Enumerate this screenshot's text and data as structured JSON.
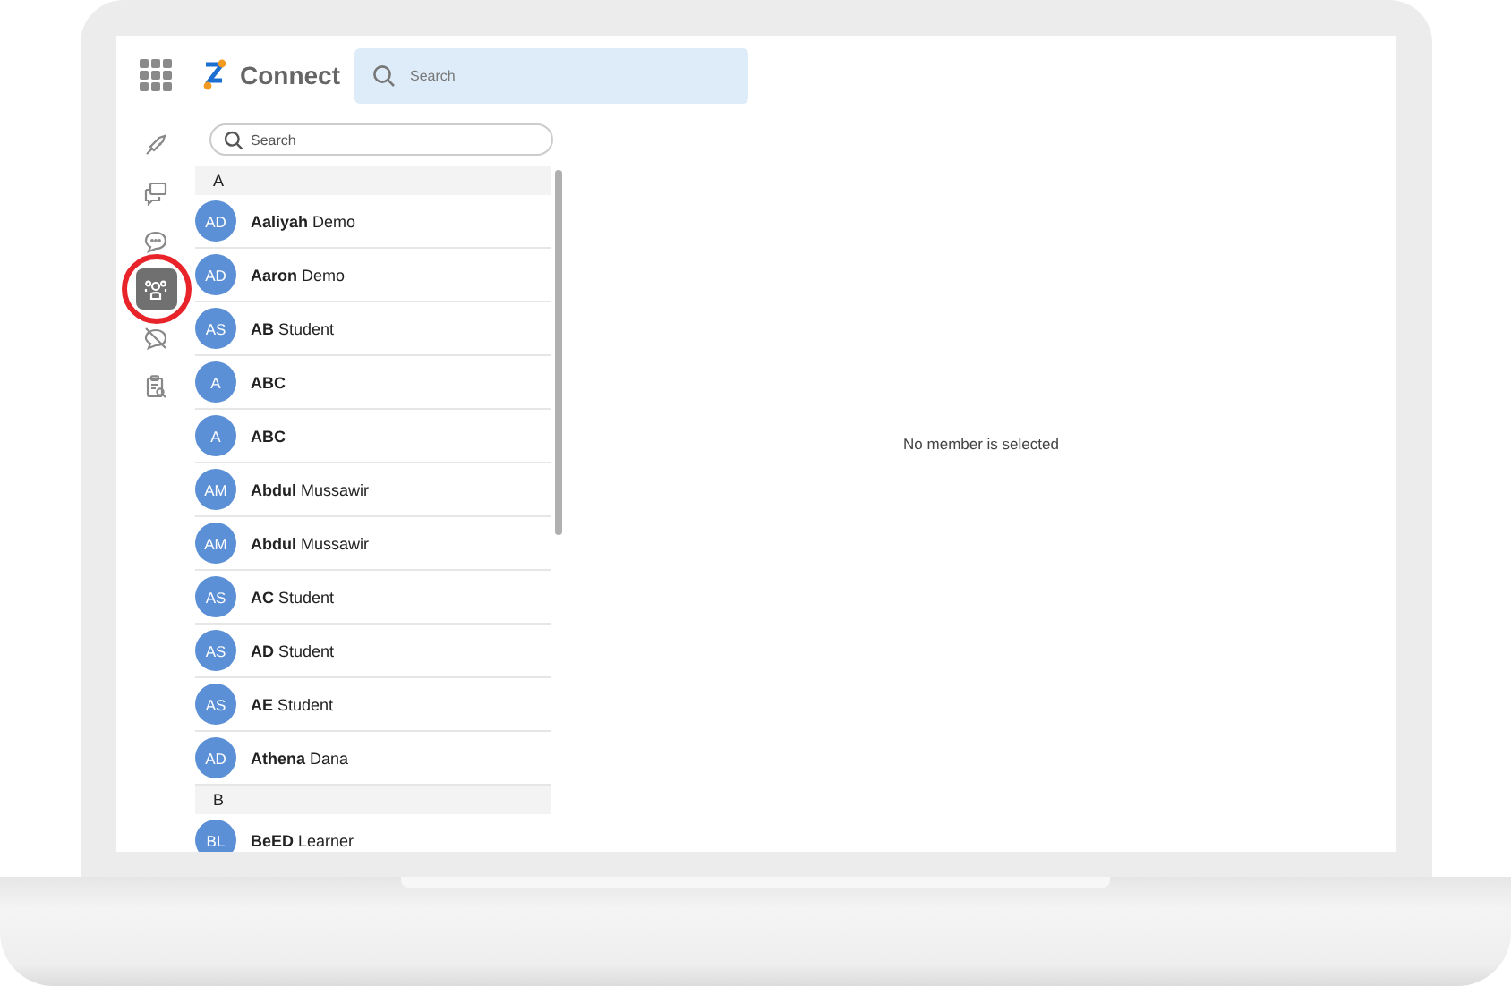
{
  "app": {
    "title": "Connect"
  },
  "top_search": {
    "placeholder": "Search"
  },
  "sidebar": {
    "items": [
      {
        "kind": "rocket",
        "selected": false,
        "annotated": false
      },
      {
        "kind": "chats",
        "selected": false,
        "annotated": false
      },
      {
        "kind": "chat",
        "selected": false,
        "annotated": false
      },
      {
        "kind": "people",
        "selected": true,
        "annotated": true
      },
      {
        "kind": "chat-off",
        "selected": false,
        "annotated": false
      },
      {
        "kind": "clipboard",
        "selected": false,
        "annotated": false
      }
    ]
  },
  "member_search": {
    "placeholder": "Search"
  },
  "sections": [
    {
      "letter": "A",
      "members": [
        {
          "initials": "AD",
          "name": "**Aaliyah** Demo"
        },
        {
          "initials": "AD",
          "name": "**Aaron** Demo"
        },
        {
          "initials": "AS",
          "name": "**AB** Student"
        },
        {
          "initials": "A",
          "name": "**ABC**"
        },
        {
          "initials": "A",
          "name": "**ABC**"
        },
        {
          "initials": "AM",
          "name": "**Abdul** Mussawir"
        },
        {
          "initials": "AM",
          "name": "**Abdul** Mussawir"
        },
        {
          "initials": "AS",
          "name": "**AC** Student"
        },
        {
          "initials": "AS",
          "name": "**AD** Student"
        },
        {
          "initials": "AS",
          "name": "**AE** Student"
        },
        {
          "initials": "AD",
          "name": "**Athena** Dana"
        }
      ]
    },
    {
      "letter": "B",
      "members": [
        {
          "initials": "BL",
          "name": "**BeED** Learner"
        }
      ]
    }
  ],
  "detail": {
    "empty_message": "No member is selected"
  }
}
